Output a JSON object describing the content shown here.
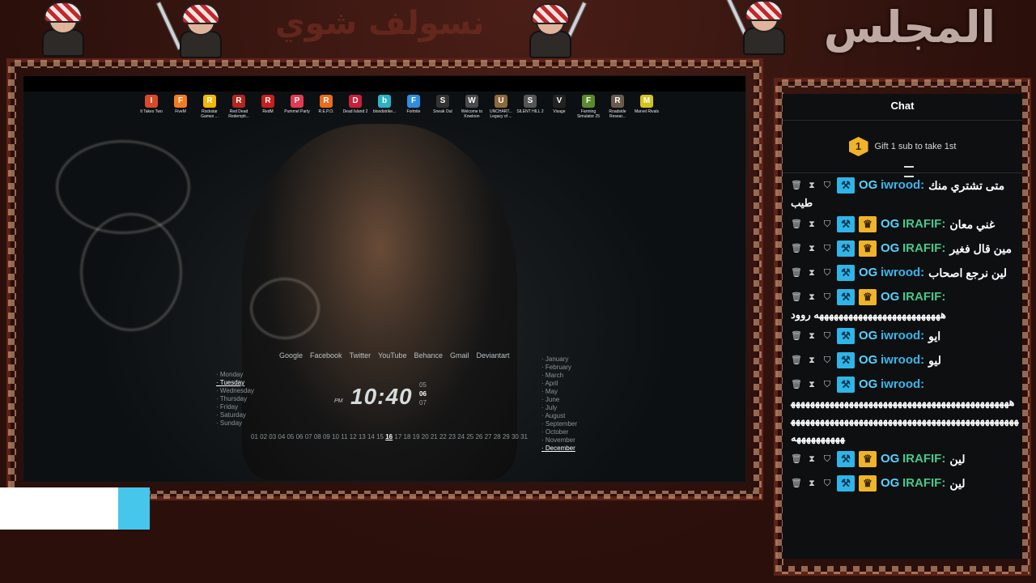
{
  "banner": {
    "title": "المجلس",
    "subtitle": "نسولف شوي"
  },
  "desktop": {
    "icons": [
      {
        "label": "It Takes Two",
        "icon": "game-icon",
        "color": "#d84a2a"
      },
      {
        "label": "FiveM",
        "icon": "fivem-icon",
        "color": "#f47c20"
      },
      {
        "label": "Rockstar Games ...",
        "icon": "rockstar-icon",
        "color": "#f2b705"
      },
      {
        "label": "Red Dead Redempti...",
        "icon": "rdr-icon",
        "color": "#b3261e"
      },
      {
        "label": "RedM",
        "icon": "redm-icon",
        "color": "#c81e1e"
      },
      {
        "label": "Pummel Party",
        "icon": "pummel-icon",
        "color": "#e23b52"
      },
      {
        "label": "R.E.P.O.",
        "icon": "repo-icon",
        "color": "#e86d1e"
      },
      {
        "label": "Dead Island 2",
        "icon": "deadisland-icon",
        "color": "#c91f3a"
      },
      {
        "label": "bloodstrike...",
        "icon": "bloodstrike-icon",
        "color": "#2bb3c4"
      },
      {
        "label": "Fortnite",
        "icon": "fortnite-icon",
        "color": "#2f8ee0"
      },
      {
        "label": "Sneak Out",
        "icon": "sneakout-icon",
        "color": "#333333"
      },
      {
        "label": "Welcome to Kowloon",
        "icon": "kowloon-icon",
        "color": "#4a4a4a"
      },
      {
        "label": "UNCHART... Legacy of ...",
        "icon": "uncharted-icon",
        "color": "#8a6a3a"
      },
      {
        "label": "SILENT HILL 2",
        "icon": "silenthill-icon",
        "color": "#555555"
      },
      {
        "label": "Visage",
        "icon": "visage-icon",
        "color": "#222222"
      },
      {
        "label": "Farming Simulator 25",
        "icon": "farming-icon",
        "color": "#5b8a2a"
      },
      {
        "label": "Roadside Resear...",
        "icon": "roadside-icon",
        "color": "#6a5a4a"
      },
      {
        "label": "Marvel Rivals",
        "icon": "marvel-icon",
        "color": "#d6c21e"
      }
    ],
    "links": [
      "Google",
      "Facebook",
      "Twitter",
      "YouTube",
      "Behance",
      "Gmail",
      "Deviantart"
    ],
    "days": [
      "Monday",
      "Tuesday",
      "Wednesday",
      "Thursday",
      "Friday",
      "Saturday",
      "Sunday"
    ],
    "active_day": "Tuesday",
    "months": [
      "January",
      "February",
      "March",
      "April",
      "May",
      "June",
      "July",
      "August",
      "September",
      "October",
      "November",
      "December"
    ],
    "active_month": "December",
    "clock": {
      "time": "10:40",
      "ampm": "PM",
      "sec_prev": "05",
      "sec_cur": "06",
      "sec_next": "07"
    },
    "dates_before": "01 02 03 04 05 06 07 08 09 10 11 12 13 14 15",
    "active_date": "16",
    "dates_after": "17 18 19 20 21 22 23 24 25 26 27 28 29 30 31"
  },
  "chat": {
    "title": "Chat",
    "gift_rank": "1",
    "gift_text": "Gift 1 sub to take 1st",
    "messages": [
      {
        "user": "iwrood",
        "color": "#3ab6ea",
        "crown": false,
        "text": "متى تشتري منك",
        "wrap": "طيب"
      },
      {
        "user": "IRAFIF",
        "color": "#47c88a",
        "crown": true,
        "text": "غني معان",
        "wrap": ""
      },
      {
        "user": "IRAFIF",
        "color": "#47c88a",
        "crown": true,
        "text": "مين قال فغير",
        "wrap": ""
      },
      {
        "user": "iwrood",
        "color": "#3ab6ea",
        "crown": false,
        "text": "لين نرجع اصحاب",
        "wrap": ""
      },
      {
        "user": "IRAFIF",
        "color": "#47c88a",
        "crown": true,
        "text": "",
        "wrap": "ههههههههههههههههههههههههههه روود"
      },
      {
        "user": "iwrood",
        "color": "#3ab6ea",
        "crown": false,
        "text": "ايو",
        "wrap": ""
      },
      {
        "user": "iwrood",
        "color": "#3ab6ea",
        "crown": false,
        "text": "ليو",
        "wrap": ""
      },
      {
        "user": "iwrood",
        "color": "#3ab6ea",
        "crown": false,
        "text": "",
        "wrap": "هههههههههههههههههههههههههههههههههههههههههههههههههههههههههههههههههههههههههههههههههههههههههههههههههههههههه"
      },
      {
        "user": "IRAFIF",
        "color": "#47c88a",
        "crown": true,
        "text": "لين",
        "wrap": ""
      },
      {
        "user": "IRAFIF",
        "color": "#47c88a",
        "crown": true,
        "text": "لين",
        "wrap": ""
      }
    ]
  }
}
